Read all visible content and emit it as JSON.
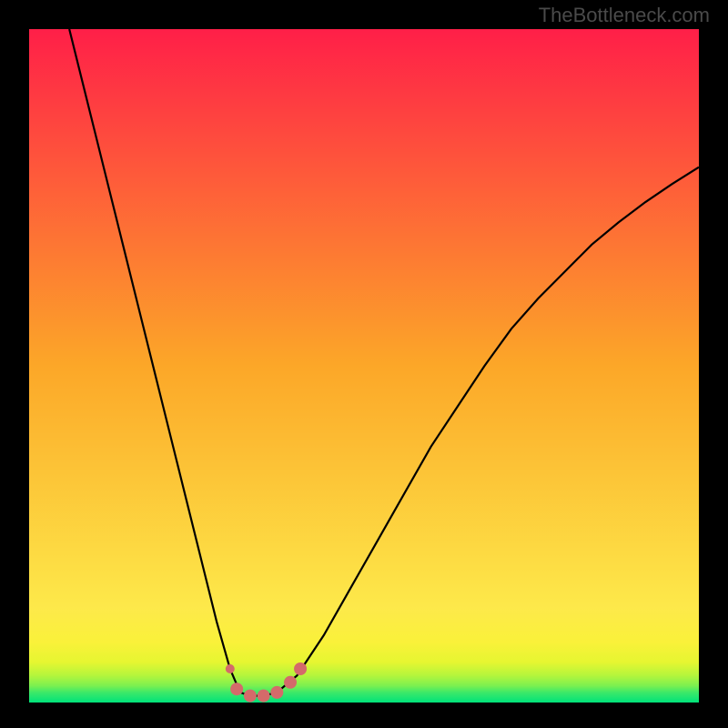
{
  "watermark": "TheBottleneck.com",
  "chart_data": {
    "type": "line",
    "title": "",
    "xlabel": "",
    "ylabel": "",
    "xlim": [
      0,
      100
    ],
    "ylim": [
      0,
      100
    ],
    "series": [
      {
        "name": "curve",
        "x": [
          6,
          8,
          10,
          12,
          14,
          16,
          18,
          20,
          22,
          24,
          26,
          28,
          30,
          31.5,
          33,
          35,
          37,
          40,
          44,
          48,
          52,
          56,
          60,
          64,
          68,
          72,
          76,
          80,
          84,
          88,
          92,
          96,
          100
        ],
        "y": [
          100,
          92,
          84,
          76,
          68,
          60,
          52,
          44,
          36,
          28,
          20,
          12,
          5,
          1.5,
          1,
          1,
          1.5,
          4,
          10,
          17,
          24,
          31,
          38,
          44,
          50,
          55.5,
          60,
          64,
          68,
          71.3,
          74.3,
          77,
          79.5
        ]
      }
    ],
    "overlay_points": {
      "name": "highlight-dots",
      "color": "#d46a6a",
      "points": [
        {
          "x": 30,
          "y": 5,
          "r": 5
        },
        {
          "x": 31,
          "y": 2,
          "r": 7
        },
        {
          "x": 33,
          "y": 1,
          "r": 7
        },
        {
          "x": 35,
          "y": 1,
          "r": 7
        },
        {
          "x": 37,
          "y": 1.5,
          "r": 7
        },
        {
          "x": 39,
          "y": 3,
          "r": 7
        },
        {
          "x": 40.5,
          "y": 5,
          "r": 7
        }
      ]
    },
    "gradient_bands": [
      {
        "y": 0.0,
        "color": "#00e27a"
      },
      {
        "y": 1.0,
        "color": "#3de968"
      },
      {
        "y": 2.0,
        "color": "#7cf050"
      },
      {
        "y": 3.0,
        "color": "#b4f53c"
      },
      {
        "y": 4.0,
        "color": "#d9f82f"
      },
      {
        "y": 5.0,
        "color": "#f0f830"
      },
      {
        "y": 7.0,
        "color": "#faf23b"
      },
      {
        "y": 10.0,
        "color": "#fde94a"
      }
    ],
    "gradient_stops_main": [
      {
        "offset": 0.0,
        "color": "#ff1f48"
      },
      {
        "offset": 0.5,
        "color": "#fca728"
      },
      {
        "offset": 0.86,
        "color": "#fde94a"
      },
      {
        "offset": 0.91,
        "color": "#faf13a"
      },
      {
        "offset": 0.94,
        "color": "#e6f631"
      },
      {
        "offset": 0.96,
        "color": "#b4f53c"
      },
      {
        "offset": 0.975,
        "color": "#7cf050"
      },
      {
        "offset": 0.985,
        "color": "#3de968"
      },
      {
        "offset": 1.0,
        "color": "#00e27a"
      }
    ]
  }
}
